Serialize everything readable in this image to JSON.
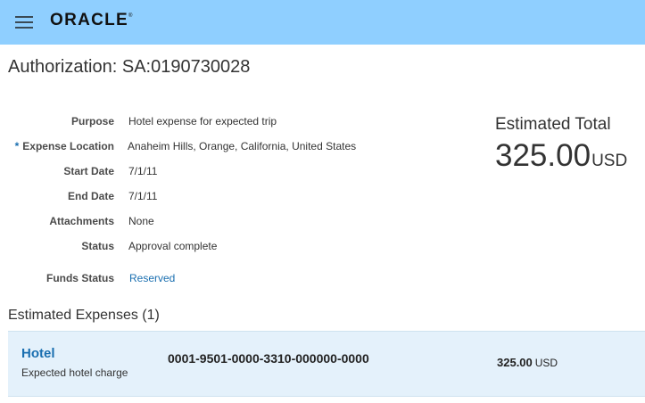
{
  "header": {
    "logo_text": "ORACLE",
    "logo_mark": "®",
    "menu_icon": "hamburger-menu-icon",
    "background_color": "#8fcfff"
  },
  "page": {
    "title": "Authorization: SA:0190730028"
  },
  "details": {
    "purpose": {
      "label": "Purpose",
      "value": "Hotel expense for expected trip"
    },
    "expense_location": {
      "required_marker": "*",
      "label": "Expense Location",
      "value": "Anaheim Hills, Orange, California, United States"
    },
    "start_date": {
      "label": "Start Date",
      "value": "7/1/11"
    },
    "end_date": {
      "label": "End Date",
      "value": "7/1/11"
    },
    "attachments": {
      "label": "Attachments",
      "value": "None"
    },
    "status": {
      "label": "Status",
      "value": "Approval complete"
    },
    "funds_status": {
      "label": "Funds Status",
      "value": "Reserved"
    }
  },
  "estimated_total": {
    "label": "Estimated Total",
    "amount": "325.00",
    "currency": "USD"
  },
  "expenses": {
    "section_title": "Estimated Expenses (1)",
    "items": [
      {
        "name": "Hotel",
        "description": "Expected hotel charge",
        "account": "0001-9501-0000-3310-000000-0000",
        "amount": "325.00",
        "currency": "USD"
      }
    ]
  },
  "colors": {
    "link": "#1a6fb0",
    "row_highlight": "#e4f1fb"
  }
}
